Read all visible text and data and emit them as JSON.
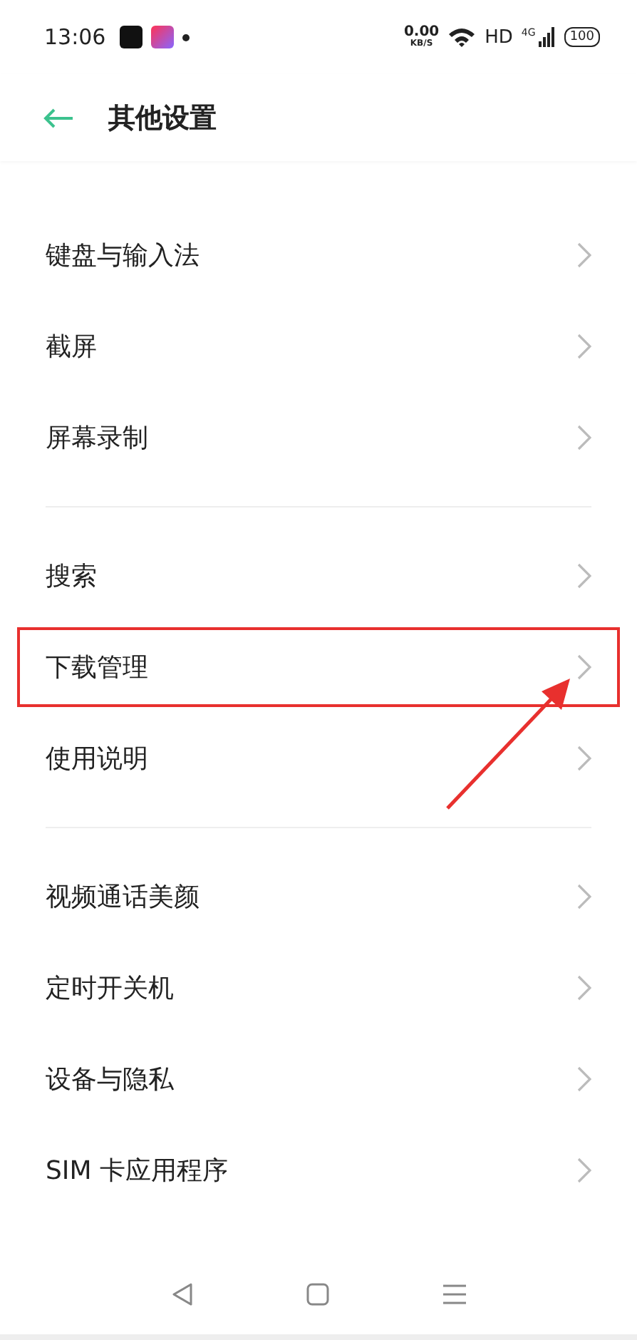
{
  "status_bar": {
    "time": "13:06",
    "data_speed": "0.00",
    "data_unit": "KB/S",
    "network": "HD",
    "signal": "4G",
    "battery": "100"
  },
  "header": {
    "title": "其他设置"
  },
  "sections": [
    {
      "items": [
        {
          "label": "键盘与输入法",
          "highlighted": false
        },
        {
          "label": "截屏",
          "highlighted": false
        },
        {
          "label": "屏幕录制",
          "highlighted": false
        }
      ]
    },
    {
      "items": [
        {
          "label": "搜索",
          "highlighted": false
        },
        {
          "label": "下载管理",
          "highlighted": true
        },
        {
          "label": "使用说明",
          "highlighted": false
        }
      ]
    },
    {
      "items": [
        {
          "label": "视频通话美颜",
          "highlighted": false
        },
        {
          "label": "定时开关机",
          "highlighted": false
        },
        {
          "label": "设备与隐私",
          "highlighted": false
        },
        {
          "label": "SIM 卡应用程序",
          "highlighted": false
        }
      ]
    }
  ]
}
